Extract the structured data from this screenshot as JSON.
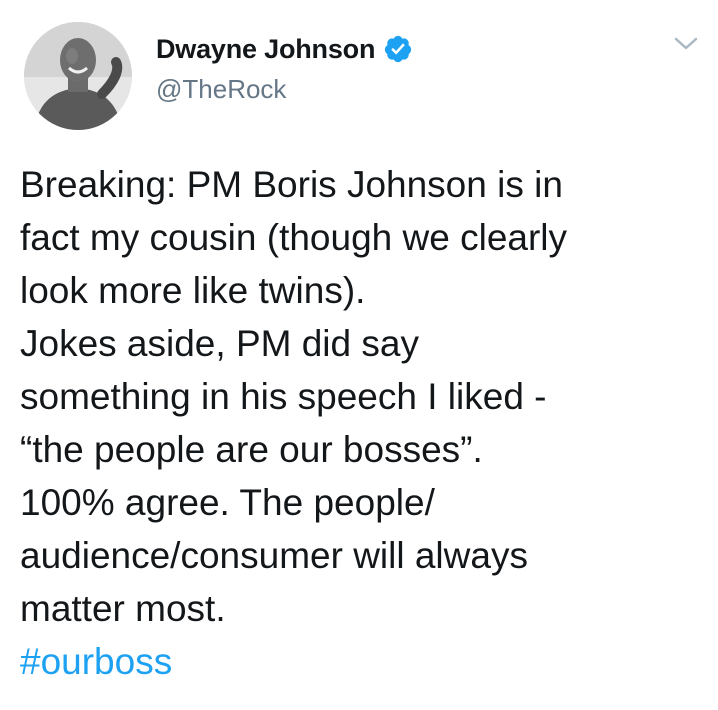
{
  "tweet": {
    "author": {
      "display_name": "Dwayne Johnson",
      "handle": "@TheRock",
      "verified": true
    },
    "text_lines": [
      "Breaking: PM Boris Johnson is in",
      "fact my cousin (though we clearly",
      "look more like twins).",
      "Jokes aside, PM did say",
      "something in his speech I liked -",
      "“the people are our bosses”.",
      "100% agree. The people/",
      "audience/consumer will always",
      "matter most."
    ],
    "hashtag": "#ourboss"
  },
  "icons": {
    "verified": "verified-badge-icon",
    "menu": "chevron-down-icon"
  },
  "colors": {
    "text": "#14171a",
    "secondary": "#657786",
    "link": "#1da1f2",
    "verified": "#1da1f2"
  }
}
